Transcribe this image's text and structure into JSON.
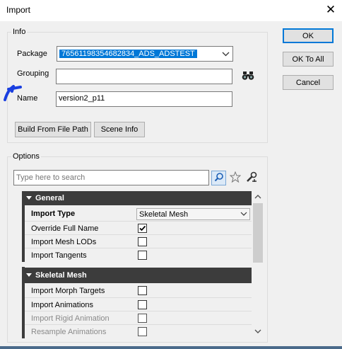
{
  "window": {
    "title": "Import",
    "close_label": "✕"
  },
  "info": {
    "legend": "Info",
    "package_label": "Package",
    "package_value": "76561198354682834_ADS_ADSTEST",
    "grouping_label": "Grouping",
    "grouping_value": "",
    "name_label": "Name",
    "name_value": "version2_p11",
    "build_button": "Build From File Path",
    "scene_button": "Scene Info"
  },
  "buttons": {
    "ok": "OK",
    "ok_to_all": "OK To All",
    "cancel": "Cancel"
  },
  "options": {
    "legend": "Options",
    "search_placeholder": "Type here to search",
    "categories": [
      {
        "label": "General",
        "rows": [
          {
            "label": "Import Type",
            "value": "Skeletal Mesh",
            "kind": "combo",
            "bold": true
          },
          {
            "label": "Override Full Name",
            "kind": "checkbox",
            "checked": true
          },
          {
            "label": "Import Mesh LODs",
            "kind": "checkbox",
            "checked": false
          },
          {
            "label": "Import Tangents",
            "kind": "checkbox",
            "checked": false
          }
        ]
      },
      {
        "label": "Skeletal Mesh",
        "rows": [
          {
            "label": "Import Morph Targets",
            "kind": "checkbox",
            "checked": false
          },
          {
            "label": "Import Animations",
            "kind": "checkbox",
            "checked": false
          },
          {
            "label": "Import Rigid Animation",
            "kind": "checkbox",
            "checked": false,
            "disabled": true
          },
          {
            "label": "Resample Animations",
            "kind": "checkbox",
            "checked": false,
            "disabled": true
          }
        ]
      }
    ]
  },
  "colors": {
    "accent": "#0078d7",
    "category_bg": "#3c3c3c",
    "annotation": "#1a3fe0"
  }
}
